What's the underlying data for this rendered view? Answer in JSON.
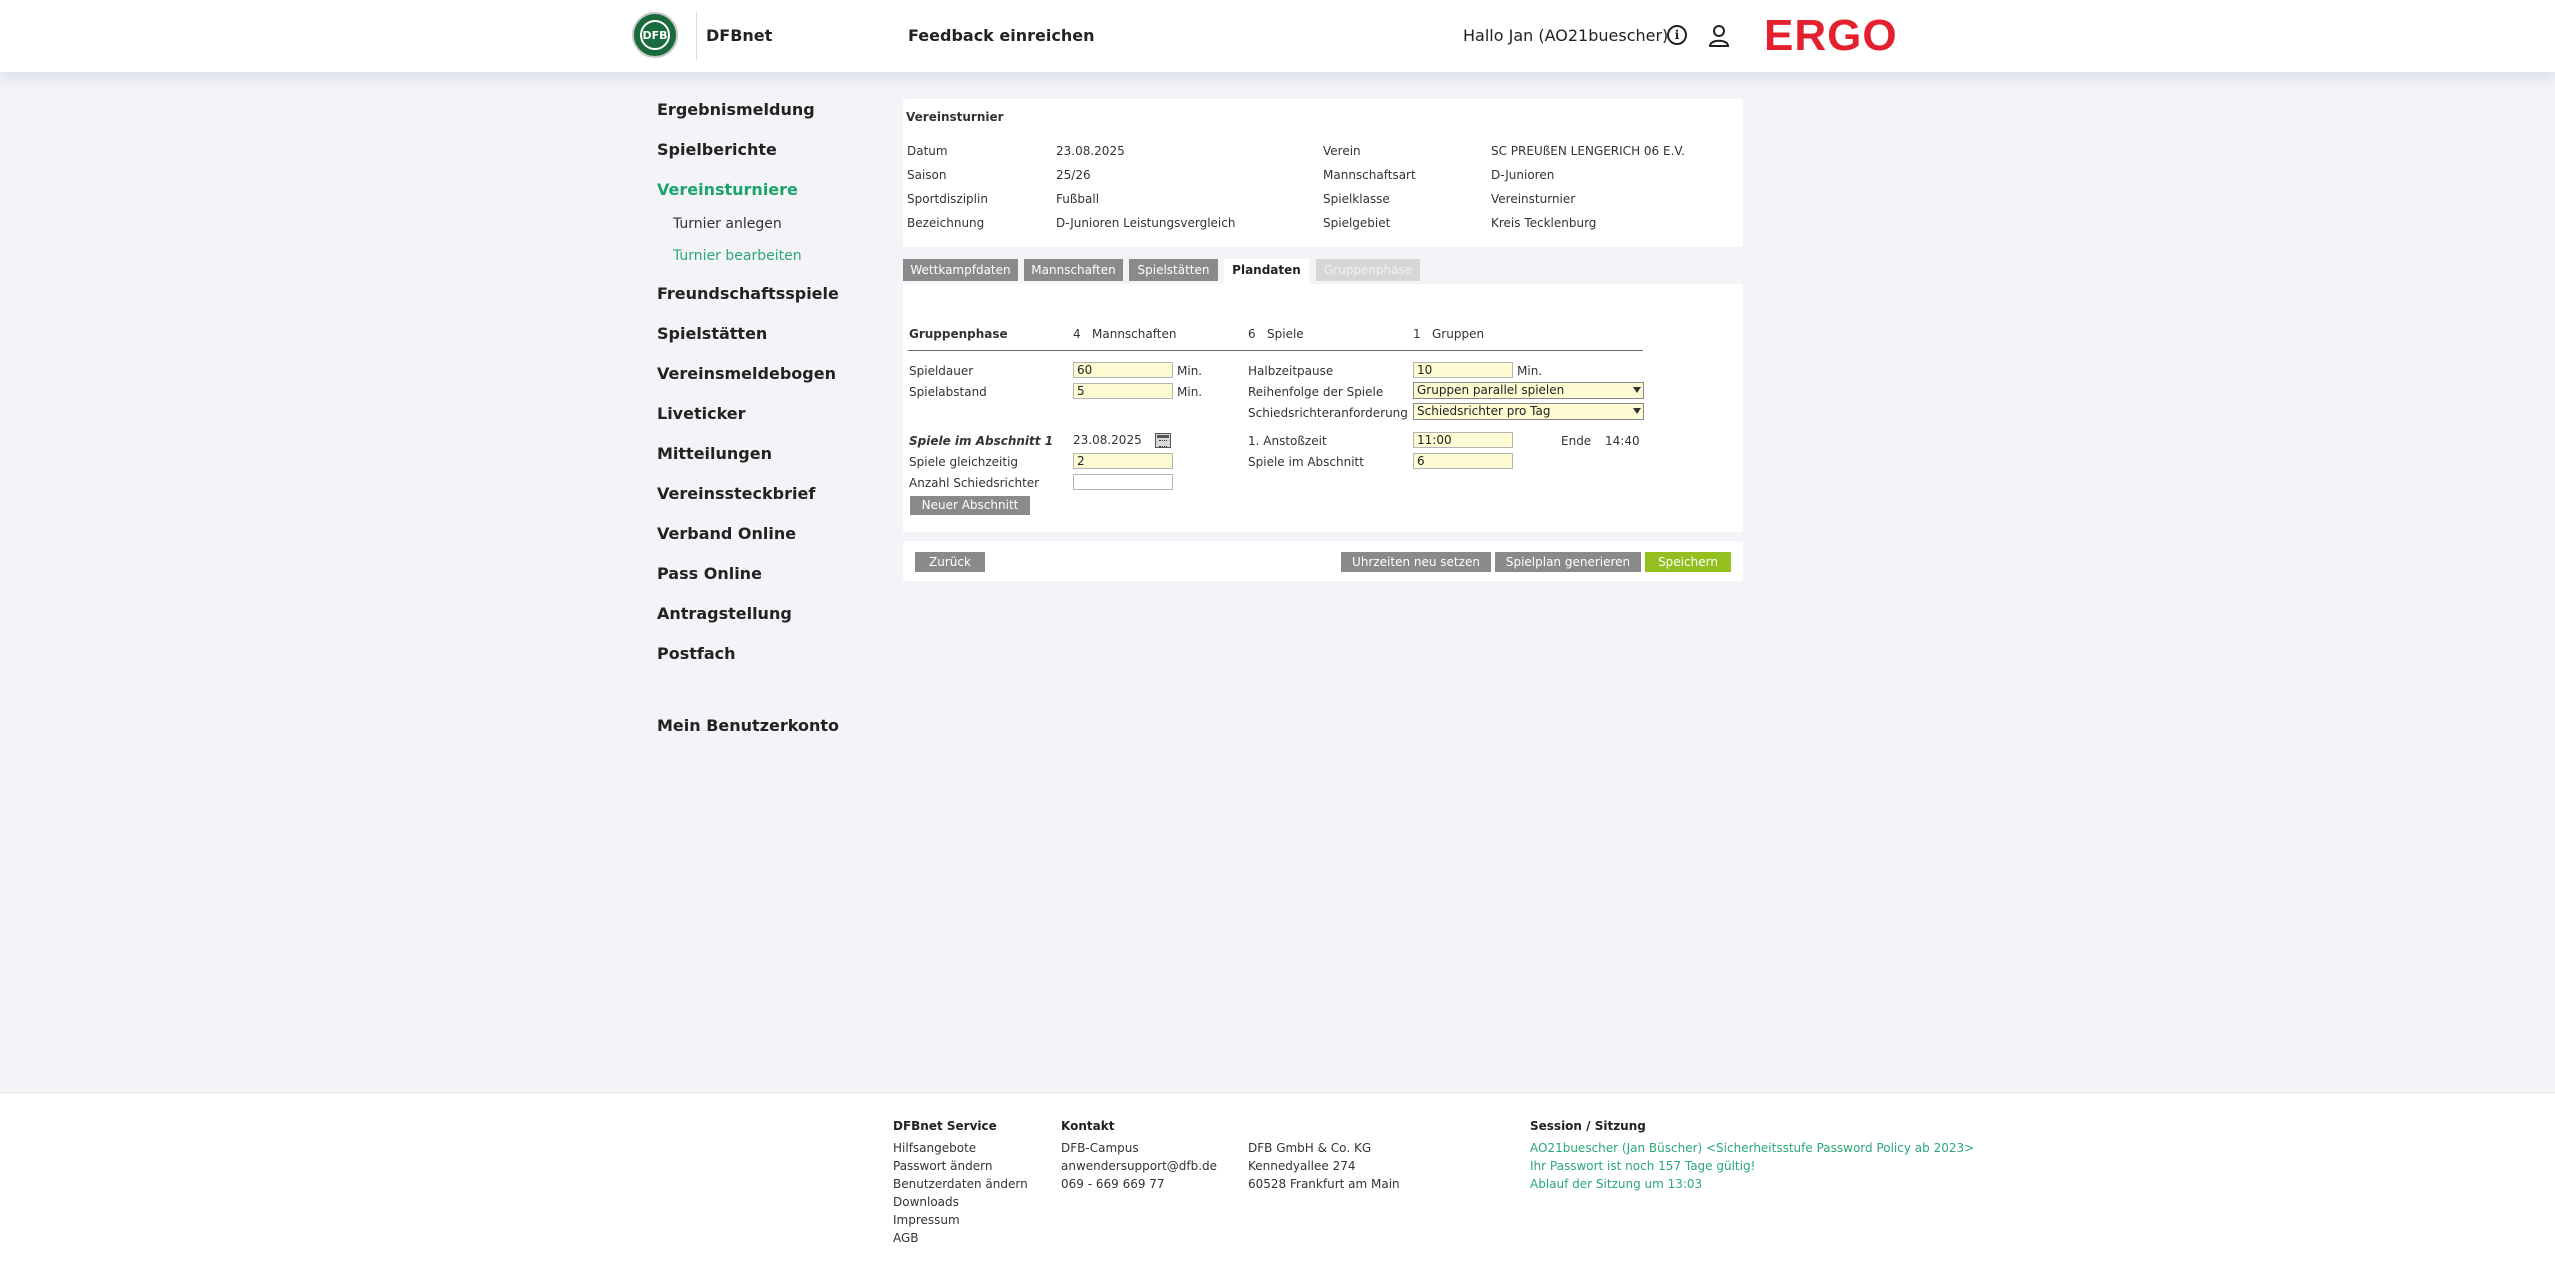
{
  "header": {
    "logo_text": "DFB",
    "brand": "DFBnet",
    "feedback": "Feedback einreichen",
    "greeting": "Hallo Jan (AO21buescher)",
    "partner_logo": "ERGO",
    "partner_color": "#e4202e",
    "info_icon": "i"
  },
  "sidebar": {
    "items": [
      {
        "label": "Ergebnismeldung"
      },
      {
        "label": "Spielberichte"
      },
      {
        "label": "Vereinsturniere"
      },
      {
        "label": "Freundschaftsspiele"
      },
      {
        "label": "Spielstätten"
      },
      {
        "label": "Vereinsmeldebogen"
      },
      {
        "label": "Liveticker"
      },
      {
        "label": "Mitteilungen"
      },
      {
        "label": "Vereinssteckbrief"
      },
      {
        "label": "Verband Online"
      },
      {
        "label": "Pass Online"
      },
      {
        "label": "Antragstellung"
      },
      {
        "label": "Postfach"
      }
    ],
    "sub_items": [
      {
        "label": "Turnier anlegen"
      },
      {
        "label": "Turnier bearbeiten"
      }
    ],
    "account": "Mein Benutzerkonto",
    "accent_color": "#1aa36a"
  },
  "tournament": {
    "title": "Vereinsturnier",
    "left": [
      {
        "label": "Datum",
        "value": "23.08.2025"
      },
      {
        "label": "Saison",
        "value": "25/26"
      },
      {
        "label": "Sportdisziplin",
        "value": "Fußball"
      },
      {
        "label": "Bezeichnung",
        "value": "D-Junioren Leistungsvergleich"
      }
    ],
    "right": [
      {
        "label": "Verein",
        "value": "SC PREUßEN LENGERICH 06 E.V."
      },
      {
        "label": "Mannschaftsart",
        "value": "D-Junioren"
      },
      {
        "label": "Spielklasse",
        "value": "Vereinsturnier"
      },
      {
        "label": "Spielgebiet",
        "value": "Kreis Tecklenburg"
      }
    ]
  },
  "tabs": [
    {
      "label": "Wettkampfdaten"
    },
    {
      "label": "Mannschaften"
    },
    {
      "label": "Spielstätten"
    },
    {
      "label": "Plandaten"
    },
    {
      "label": "Gruppenphase"
    }
  ],
  "plan": {
    "phase_label": "Gruppenphase",
    "teams_count": "4",
    "teams_label": "Mannschaften",
    "games_count": "6",
    "games_label": "Spiele",
    "groups_count": "1",
    "groups_label": "Gruppen",
    "spieldauer_label": "Spieldauer",
    "spieldauer_value": "60",
    "spielabstand_label": "Spielabstand",
    "spielabstand_value": "5",
    "min_unit": "Min.",
    "halbzeit_label": "Halbzeitpause",
    "halbzeit_value": "10",
    "reihenfolge_label": "Reihenfolge der Spiele",
    "reihenfolge_value": "Gruppen parallel spielen",
    "schiri_anf_label": "Schiedsrichteranforderung",
    "schiri_anf_value": "Schiedsrichter pro Tag",
    "abschnitt_label": "Spiele im Abschnitt 1",
    "abschnitt_date": "23.08.2025",
    "anstoss_label": "1. Anstoßzeit",
    "anstoss_value": "11:00",
    "ende_label": "Ende",
    "ende_value": "14:40",
    "gleichzeitig_label": "Spiele gleichzeitig",
    "gleichzeitig_value": "2",
    "spiele_abschnitt_label": "Spiele im Abschnitt",
    "spiele_abschnitt_value": "6",
    "anzahl_schiri_label": "Anzahl Schiedsrichter",
    "anzahl_schiri_value": "",
    "neuer_abschnitt": "Neuer Abschnitt",
    "input_bg": "#fdfbd2"
  },
  "actions": {
    "back": "Zurück",
    "reset_times": "Uhrzeiten neu setzen",
    "generate": "Spielplan generieren",
    "save": "Speichern",
    "save_color": "#93c01f"
  },
  "footer": {
    "service_title": "DFBnet Service",
    "service_links": [
      "Hilfsangebote",
      "Passwort ändern",
      "Benutzerdaten ändern",
      "Downloads",
      "Impressum",
      "AGB"
    ],
    "contact_title": "Kontakt",
    "contact_lines": [
      "DFB-Campus",
      "anwendersupport@dfb.de",
      "069 - 669 669 77"
    ],
    "address_lines": [
      "DFB GmbH & Co. KG",
      "Kennedyallee 274",
      "60528 Frankfurt am Main"
    ],
    "session_title": "Session / Sitzung",
    "session_lines": [
      "AO21buescher (Jan Büscher) <Sicherheitsstufe Password Policy ab 2023>",
      "Ihr Passwort ist noch 157 Tage gültig!",
      "Ablauf der Sitzung um 13:03"
    ]
  }
}
